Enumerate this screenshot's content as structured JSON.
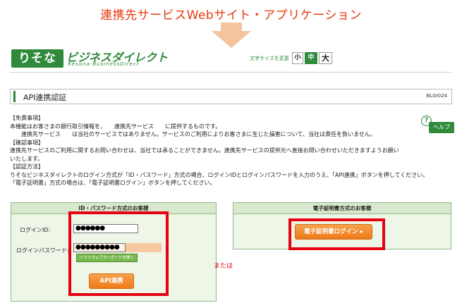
{
  "caption": "連携先サービスWebサイト・アプリケーション",
  "header": {
    "logo_main": "りそな",
    "logo_text": "ビジネスダイレクト",
    "logo_sub": "Resona-BusinessDirect",
    "font_size_label": "文字サイズを変更",
    "font_sizes": [
      "小",
      "中",
      "大"
    ]
  },
  "page": {
    "title": "API連携認証",
    "code": "BLGI024"
  },
  "help": {
    "icon": "?",
    "label": "ヘルプ"
  },
  "content": {
    "disclaimer_heading": "【免責事項】",
    "disclaimer_line1": "本機能はお客さまの銀行取引情報を、　　連携先サービス　　に提供するものです。",
    "disclaimer_line2": "　　連携先サービス　　は当社のサービスではありません。サービスのご利用によりお客さまに生じた損害について、当社は責任を負いません。",
    "confirm_heading": "【確認事項】",
    "confirm_line1": "連携先サービスのご利用に関するお問い合わせは、当社では承ることができません。連携先サービスの提供元へ直接お問い合わせいただきますようお願い",
    "confirm_line2": "いたします。",
    "auth_heading": "【認証方法】",
    "auth_line1": "りそなビジネスダイレクトのログイン方式が「ID・パスワード」方式の場合、ログインIDとログインパスワードを入力のうえ、「API連携」ボタンを押してください。",
    "auth_line2": "「電子証明書」方式の場合は、「電子証明書ログイン」ボタンを押してください。"
  },
  "id_panel": {
    "heading": "ID・パスワード方式のお客様",
    "login_id_label": "ログインID:",
    "login_id_value": "●●●●●●",
    "password_label": "ログインパスワード:",
    "password_value": "●●●●●●●●●",
    "software_keyboard_button": "ソフトウェアキーボードを開く",
    "api_button": "API連携"
  },
  "or_label": "または",
  "cert_panel": {
    "heading": "電子証明書方式のお客様",
    "login_button": "電子証明書ログイン ▸"
  },
  "colors": {
    "brand_green": "#2f8a3c",
    "highlight_red": "#e60012",
    "button_orange": "#ee7a18"
  }
}
